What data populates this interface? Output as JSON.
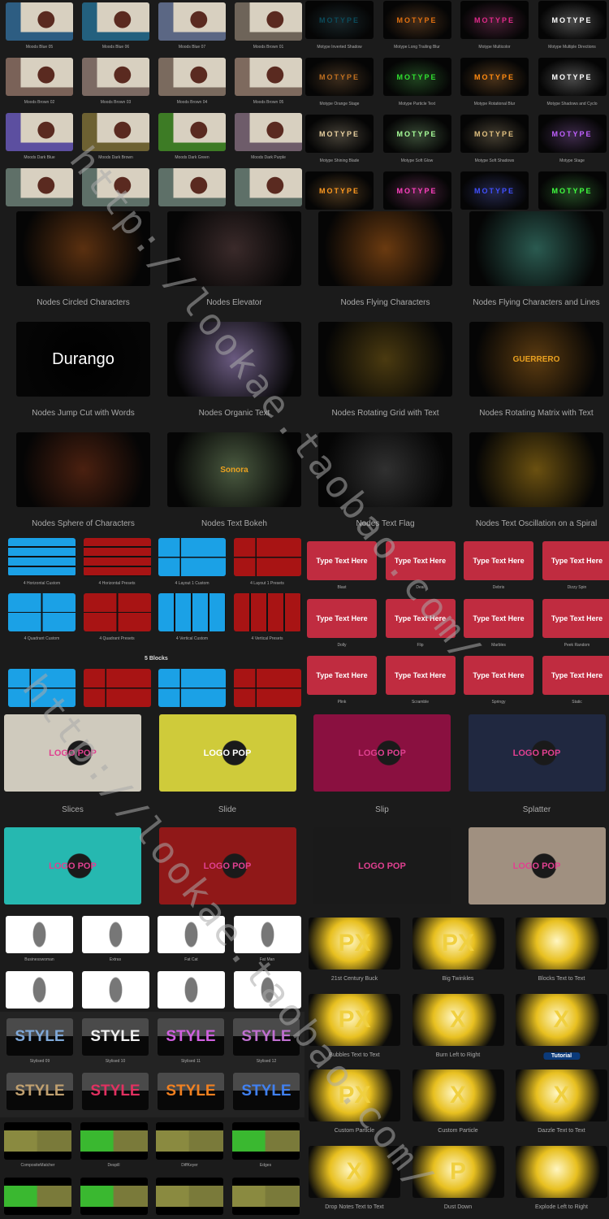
{
  "moods": {
    "items": [
      "Moods Blue 05",
      "Moods Blue 06",
      "Moods Blue 07",
      "Moods Brown 01",
      "Moods Brown 02",
      "Moods Brown 03",
      "Moods Brown 04",
      "Moods Brown 05",
      "Moods Dark Blue",
      "Moods Dark Brown",
      "Moods Dark Green",
      "Moods Dark Purple",
      "",
      "",
      "",
      ""
    ],
    "colors": [
      "#2d5d82",
      "#23607e",
      "#5b6784",
      "#6e6459",
      "#7a6258",
      "#7c6a63",
      "#7a6a5e",
      "#7e6a5e",
      "#5c4fa0",
      "#6d6132",
      "#3d7b25",
      "#6e5c6a",
      "#5f7068",
      "#5e7068",
      "#5e7068",
      "#5e7068"
    ]
  },
  "motype": {
    "items": [
      "Motype Inverted Shadow",
      "Motype Long Trailing Blur",
      "Motype Multicolor",
      "Motype Multiple Directions",
      "Motype Orange Stage",
      "Motype Particle Text",
      "Motype Rotational Blur",
      "Motype Shadows and Cyclo",
      "Motype Shining Blade",
      "Motype Soft Glow",
      "Motype Soft Shadows",
      "Motype Stage",
      "",
      "",
      "",
      ""
    ],
    "thumb_text": "MOTYPE",
    "colors": [
      "#0b4a5a",
      "#e07010",
      "#e02a8a",
      "#ffffff",
      "#c07020",
      "#30e030",
      "#ff8a10",
      "#ffffff",
      "#e8d0a0",
      "#a8ff9a",
      "#e0c080",
      "#c060ff",
      "#ff9a20",
      "#ff40c0",
      "#4050ff",
      "#40ff40"
    ]
  },
  "nodes": {
    "items": [
      "Nodes Circled Characters",
      "Nodes Elevator",
      "Nodes Flying Characters",
      "Nodes Flying Characters and Lines",
      "Nodes Jump Cut with Words",
      "Nodes Organic Text",
      "Nodes Rotating Grid with Text",
      "Nodes Rotating Matrix with Text",
      "Nodes Sphere of Characters",
      "Nodes Text Bokeh",
      "Nodes Text Flag",
      "Nodes Text Oscillation on a Spiral"
    ],
    "thumb_texts": [
      "",
      "",
      "",
      "",
      "Durango",
      "",
      "",
      "GUERRERO",
      "",
      "Sonora",
      "",
      ""
    ],
    "colors": [
      "#5a3010",
      "#3a2a2a",
      "#6a3a10",
      "#2a5a50",
      "#000000",
      "#6a5a80",
      "#4a3a10",
      "#5a3a10",
      "#4a2010",
      "#4a5a40",
      "#303030",
      "#6a5010"
    ]
  },
  "blocks": {
    "items": [
      "4 Horizontal Custom",
      "4 Horizontal Presets",
      "4 Layout 1 Custom",
      "4 Layout 1 Presets",
      "4 Quadrant Custom",
      "4 Quadrant Presets",
      "4 Vertical Custom",
      "4 Vertical Presets",
      "",
      "",
      "",
      ""
    ],
    "heading": "5 Blocks",
    "blue": "#1ba1e6",
    "red": "#a81414"
  },
  "typetext": {
    "items": [
      "Blast",
      "Deal",
      "Debris",
      "Dizzy Spin",
      "Dolly",
      "Flip",
      "Marbles",
      "Peek Random",
      "Plink",
      "Scramble",
      "Springy",
      "Static"
    ],
    "thumb_text": "Type Text Here",
    "color": "#c02c40"
  },
  "logo": {
    "items": [
      "Slices",
      "Slide",
      "Slip",
      "Splatter",
      "",
      "",
      "",
      ""
    ],
    "thumb_text": "LOGO POP",
    "colors": [
      "#cfcabd",
      "#cfcb3a",
      "#8a1040",
      "#202840",
      "#26b8b0",
      "#901818",
      "#1a1a1a",
      "#a09080"
    ]
  },
  "characters": {
    "items": [
      "Businesswoman",
      "Extras",
      "Fat Cat",
      "Fat Man",
      "",
      "",
      "",
      ""
    ]
  },
  "style": {
    "items": [
      "Stylised 09",
      "Stylised 10",
      "Stylised 11",
      "Stylised 12",
      "",
      "",
      "",
      ""
    ],
    "thumb_text": "STYLE",
    "colors": [
      "#7fa8d8",
      "#f0f0f0",
      "#d060e0",
      "#c070d0",
      "#c0a070",
      "#e03060",
      "#f08020",
      "#4080f0"
    ]
  },
  "keyers": {
    "items": [
      "CompositeMatcher",
      "Despill",
      "DiffKeyer",
      "Edges",
      "",
      "",
      "",
      ""
    ]
  },
  "px": {
    "items": [
      "21st Century Buck",
      "Big Twinkles",
      "Blocks Text to Text",
      "Bubbles Text to Text",
      "Burn Left to Right",
      "Tutorial",
      "Custom Particle",
      "Custom Particle",
      "Dazzle Text to Text",
      "Drop Notes Text to Text",
      "Dust Down",
      "Explode Left to Right"
    ],
    "thumb_texts": [
      "PX",
      "PX",
      "",
      "PX",
      "X",
      "X",
      "PX",
      "X",
      "X",
      "X",
      "P",
      ""
    ],
    "accent": "#e8c020"
  },
  "watermark": "http://lookae.taobao.com/"
}
